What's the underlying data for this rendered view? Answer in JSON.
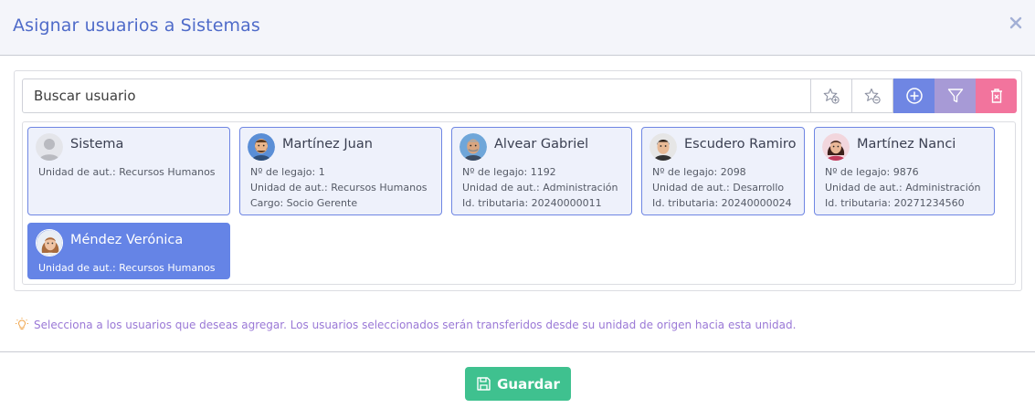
{
  "modal": {
    "title": "Asignar usuarios a Sistemas",
    "close_icon": "close-icon"
  },
  "search": {
    "placeholder": "Buscar usuario",
    "value": ""
  },
  "toolbar": {
    "buttons": [
      {
        "icon": "star-plus-icon",
        "style": "outline"
      },
      {
        "icon": "star-minus-icon",
        "style": "outline"
      },
      {
        "icon": "plus-circle-icon",
        "color": "#6f86e3"
      },
      {
        "icon": "filter-icon",
        "color": "#a79ad6"
      },
      {
        "icon": "trash-icon",
        "color": "#f2749d"
      }
    ]
  },
  "users": [
    {
      "name": "Sistema",
      "avatar": "default-avatar",
      "selected": false,
      "lines": [
        "Unidad de aut.: Recursos Humanos"
      ]
    },
    {
      "name": "Martínez Juan",
      "avatar": "bearded-man-avatar",
      "selected": false,
      "lines": [
        "Nº de legajo: 1",
        "Unidad de aut.: Recursos Humanos",
        "Cargo: Socio Gerente"
      ]
    },
    {
      "name": "Alvear Gabriel",
      "avatar": "older-man-avatar",
      "selected": false,
      "lines": [
        "Nº de legajo: 1192",
        "Unidad de aut.: Administración",
        "Id. tributaria: 20240000011"
      ]
    },
    {
      "name": "Escudero Ramiro",
      "avatar": "young-man-avatar",
      "selected": false,
      "lines": [
        "Nº de legajo: 2098",
        "Unidad de aut.: Desarrollo",
        "Id. tributaria: 20240000024"
      ]
    },
    {
      "name": "Martínez Nanci",
      "avatar": "woman-dark-hair-avatar",
      "selected": false,
      "lines": [
        "Nº de legajo: 9876",
        "Unidad de aut.: Administración",
        "Id. tributaria: 20271234560"
      ]
    },
    {
      "name": "Méndez Verónica",
      "avatar": "woman-light-hair-avatar",
      "selected": true,
      "lines": [
        "Unidad de aut.: Recursos Humanos"
      ]
    }
  ],
  "info": {
    "icon": "lightbulb-icon",
    "text": "Selecciona a los usuarios que deseas agregar. Los usuarios seleccionados serán transferidos desde su unidad de origen hacia esta unidad."
  },
  "footer": {
    "save_label": "Guardar",
    "save_icon": "floppy-disk-icon"
  },
  "colors": {
    "title": "#4f6bc9",
    "card_border": "#6f86e3",
    "card_bg": "#eef1fb",
    "selected_card_bg": "#6584e6",
    "info_text": "#9a78d6",
    "save_button": "#3fc18f"
  }
}
